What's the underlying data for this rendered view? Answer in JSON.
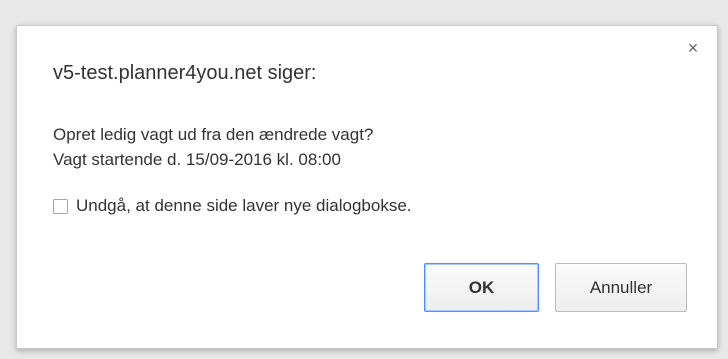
{
  "dialog": {
    "title": "v5-test.planner4you.net siger:",
    "close_icon": "×",
    "message_line1": "Opret ledig vagt ud fra den ændrede vagt?",
    "message_line2": "Vagt startende d. 15/09-2016 kl. 08:00",
    "suppress_label": "Undgå, at denne side laver nye dialogbokse.",
    "suppress_checked": false,
    "ok_label": "OK",
    "cancel_label": "Annuller"
  },
  "colors": {
    "focus_border": "#4d90fe",
    "backdrop": "#e8e8e8"
  }
}
